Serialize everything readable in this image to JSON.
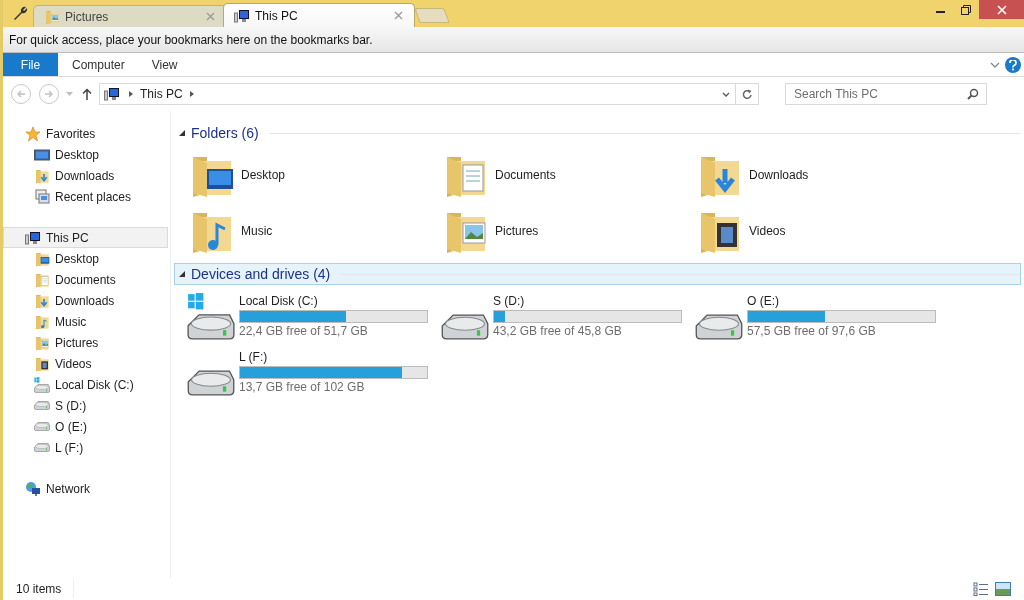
{
  "browser_tabs": [
    {
      "label": "Pictures",
      "kind": "pictures",
      "selected": false
    },
    {
      "label": "This PC",
      "kind": "pc",
      "selected": true
    }
  ],
  "bookmarks_bar": {
    "message": "For quick access, place your bookmarks here on the bookmarks bar."
  },
  "ribbon_tabs": [
    {
      "label": "File",
      "selected": true
    },
    {
      "label": "Computer",
      "selected": false
    },
    {
      "label": "View",
      "selected": false
    }
  ],
  "address_bar": {
    "path": "This PC"
  },
  "search": {
    "placeholder": "Search This PC"
  },
  "sidebar": [
    {
      "label": "Favorites",
      "kind": "star",
      "selected": false,
      "children": [
        {
          "label": "Desktop",
          "kind": "desktop",
          "selected": false
        },
        {
          "label": "Downloads",
          "kind": "downloads",
          "selected": false
        },
        {
          "label": "Recent places",
          "kind": "recent",
          "selected": false
        }
      ]
    },
    {
      "label": "This PC",
      "kind": "pc",
      "selected": true,
      "children": [
        {
          "label": "Desktop",
          "kind": "folder-desktop",
          "selected": false
        },
        {
          "label": "Documents",
          "kind": "documents",
          "selected": false
        },
        {
          "label": "Downloads",
          "kind": "downloads",
          "selected": false
        },
        {
          "label": "Music",
          "kind": "music",
          "selected": false
        },
        {
          "label": "Pictures",
          "kind": "pictures",
          "selected": false
        },
        {
          "label": "Videos",
          "kind": "videos",
          "selected": false
        },
        {
          "label": "Local Disk (C:)",
          "kind": "system-drive",
          "selected": false
        },
        {
          "label": "S (D:)",
          "kind": "drive",
          "selected": false
        },
        {
          "label": "O (E:)",
          "kind": "drive",
          "selected": false
        },
        {
          "label": "L (F:)",
          "kind": "drive",
          "selected": false
        }
      ]
    },
    {
      "label": "Network",
      "kind": "network",
      "selected": false
    }
  ],
  "sections": [
    {
      "title": "Folders (6)",
      "kind": "folders",
      "selected": false,
      "items": [
        {
          "label": "Desktop",
          "kind": "folder-desktop"
        },
        {
          "label": "Documents",
          "kind": "documents"
        },
        {
          "label": "Downloads",
          "kind": "downloads"
        },
        {
          "label": "Music",
          "kind": "music"
        },
        {
          "label": "Pictures",
          "kind": "pictures"
        },
        {
          "label": "Videos",
          "kind": "videos"
        }
      ]
    },
    {
      "title": "Devices and drives (4)",
      "kind": "drives",
      "selected": true,
      "items": [
        {
          "label": "Local Disk (C:)",
          "kind": "system-drive",
          "level": 0.567,
          "free": "22,4 GB free of 51,7 GB"
        },
        {
          "label": "S (D:)",
          "kind": "drive",
          "level": 0.057,
          "free": "43,2 GB free of 45,8 GB"
        },
        {
          "label": "O (E:)",
          "kind": "drive",
          "level": 0.411,
          "free": "57,5 GB free of 97,6 GB"
        },
        {
          "label": "L (F:)",
          "kind": "drive",
          "level": 0.866,
          "free": "13,7 GB free of 102 GB"
        }
      ]
    }
  ],
  "status_bar": {
    "count": "10 items"
  }
}
